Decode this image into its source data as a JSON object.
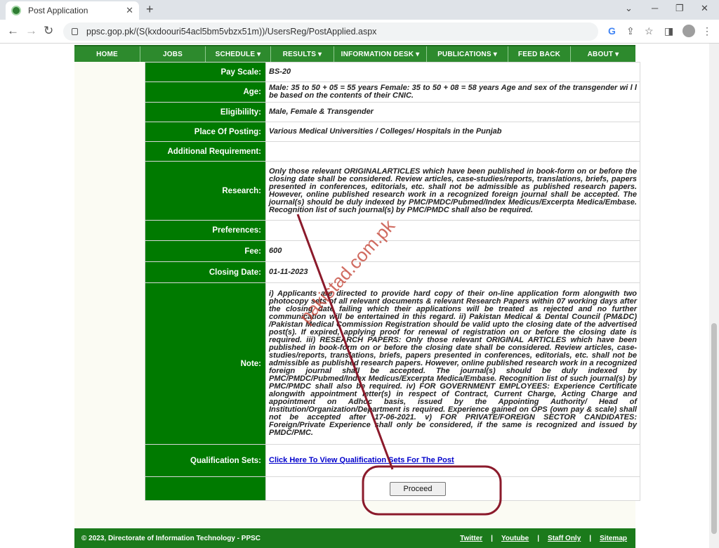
{
  "browser": {
    "tab_title": "Post Application",
    "tab_close": "✕",
    "new_tab": "+",
    "url": "ppsc.gop.pk/(S(kxdoouri54acl5bm5vbzx51m))/UsersReg/PostApplied.aspx",
    "back": "←",
    "forward": "→",
    "reload": "↻",
    "window_minimize": "─",
    "window_restore": "❐",
    "window_close": "✕",
    "chevron": "⌄"
  },
  "menu": [
    {
      "label": "HOME"
    },
    {
      "label": "JOBS"
    },
    {
      "label": "SCHEDULE ▾"
    },
    {
      "label": "RESULTS ▾"
    },
    {
      "label": "INFORMATION DESK ▾"
    },
    {
      "label": "PUBLICATIONS ▾"
    },
    {
      "label": "FEED BACK"
    },
    {
      "label": "ABOUT ▾"
    }
  ],
  "details": {
    "pay_scale": {
      "label": "Pay Scale:",
      "value": "BS-20"
    },
    "age": {
      "label": "Age:",
      "value": "Male: 35 to 50 + 05 = 55 years Female: 35 to 50 + 08 = 58 years Age and sex of the transgender wi l l be based on the contents of their CNIC."
    },
    "eligibility": {
      "label": "Eligibililty:",
      "value": "Male, Female & Transgender"
    },
    "place_of_posting": {
      "label": "Place Of Posting:",
      "value": "Various Medical Universities / Colleges/ Hospitals in the Punjab"
    },
    "additional_requirement": {
      "label": "Additional Requirement:",
      "value": ""
    },
    "research": {
      "label": "Research:",
      "value": "Only those relevant ORIGINALARTICLES which have been published in book-form on or before the closing date shall be considered. Review articles, case-studies/reports, translations, briefs, papers presented in conferences, editorials, etc. shall not be admissible as published research papers. However, online published research work in a recognized foreign journal shall be accepted. The journal(s) should be duly indexed by PMC/PMDC/Pubmed/Index Medicus/Excerpta Medica/Embase. Recognition list of such journal(s) by PMC/PMDC shall also be required."
    },
    "preferences": {
      "label": "Preferences:",
      "value": ""
    },
    "fee": {
      "label": "Fee:",
      "value": "600"
    },
    "closing_date": {
      "label": "Closing Date:",
      "value": "01-11-2023"
    },
    "note": {
      "label": "Note:",
      "value": "i) Applicants are directed to provide hard copy of their on-line application form alongwith two photocopy sets of all relevant documents & relevant Research Papers within 07 working days after the closing date failing which their applications will be treated as rejected and no further communication will be entertained in this regard. ii) Pakistan Medical & Dental Council (PM&DC) /Pakistan Medical Commission Registration should be valid upto the closing date of the advertised post(s). If expired, applying proof for renewal of registration on or before the closing date is required. iii) RESEARCH PAPERS: Only those relevant ORIGINAL ARTICLES which have been published in book-form on or before the closing date shall be considered. Review articles, case-studies/reports, translations, briefs, papers presented in conferences, editorials, etc. shall not be admissible as published research papers. However, online published research work in a recognized foreign journal shall be accepted. The journal(s) should be duly indexed by PMC/PMDC/Pubmed/Index Medicus/Excerpta Medica/Embase. Recognition list of such journal(s) by PMC/PMDC shall also be required. iv) FOR GOVERNMENT EMPLOYEES: Experience Certificate alongwith appointment letter(s) in respect of Contract, Current Charge, Acting Charge and appointment on Adhoc basis, issued by the Appointing Authority/ Head of Institution/Organization/Department is required. Experience gained on OPS (own pay & scale) shall not be accepted after 17-06-2021. v) FOR PRIVATE/FOREIGN SECTOR CANDIDATES: Foreign/Private Experience shall only be considered, if the same is recognized and issued by PMDC/PMC."
    },
    "qualification_sets": {
      "label": "Qualification Sets:",
      "link": "Click Here To View Qualification Sets For The Post"
    }
  },
  "proceed_label": "Proceed",
  "footer": {
    "copyright": "© 2023, Directorate of Information Technology - PPSC",
    "links": [
      "Twitter",
      "Youtube",
      "Staff Only",
      "Sitemap"
    ],
    "separator": "|"
  },
  "watermark": "pakistad.com.pk",
  "annotation_color": "#8b1a2b"
}
